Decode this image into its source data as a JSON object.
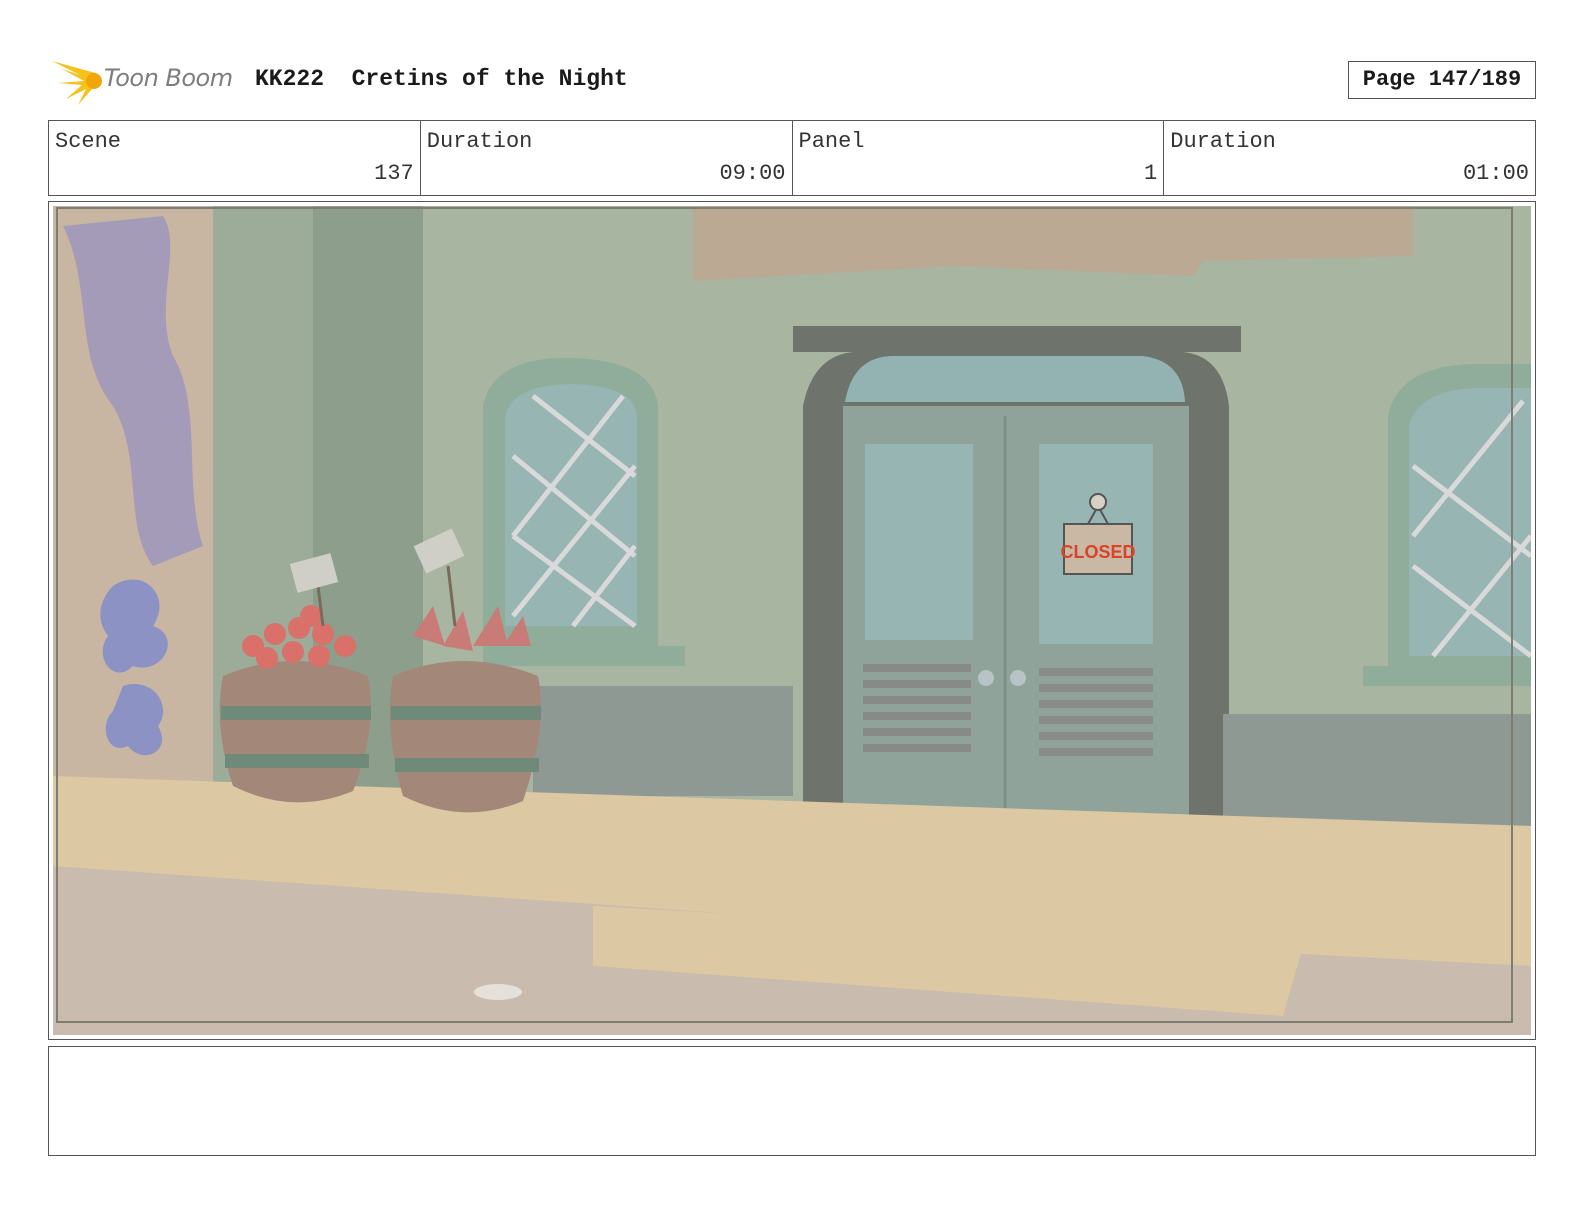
{
  "header": {
    "logo_text": "Toon Boom",
    "production": "KK222",
    "episode_title": "Cretins of the Night",
    "page_label": "Page 147/189"
  },
  "info": {
    "scene_label": "Scene",
    "scene_value": "137",
    "scene_duration_label": "Duration",
    "scene_duration_value": "09:00",
    "panel_label": "Panel",
    "panel_value": "1",
    "panel_duration_label": "Duration",
    "panel_duration_value": "01:00"
  },
  "panel_image": {
    "sign_text": "CLOSED"
  },
  "notes": {
    "text": ""
  }
}
